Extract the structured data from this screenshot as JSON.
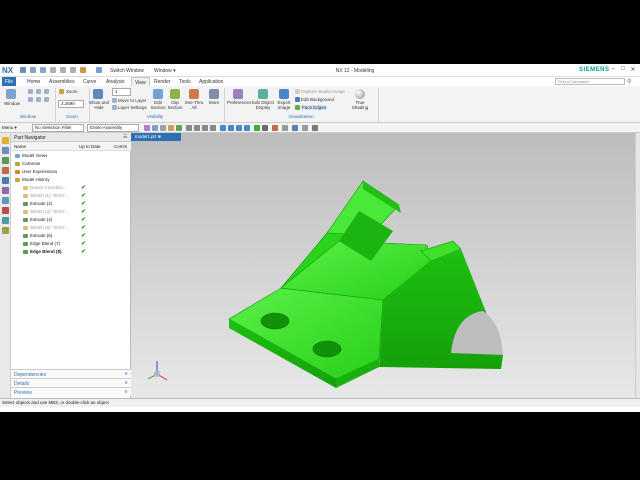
{
  "app": {
    "logo": "NX",
    "title": "NX 12 - Modeling",
    "switch_window": "Switch Window",
    "window_menu": "Window ▾",
    "brand": "SIEMENS",
    "win_min": "–",
    "win_max": "□",
    "win_close": "✕"
  },
  "tabs": [
    "File",
    "Home",
    "Assemblies",
    "Curve",
    "Analysis",
    "View",
    "Render",
    "Tools",
    "Application"
  ],
  "search_placeholder": "Find a Command",
  "ribbon": {
    "window_btn": "Window",
    "zoom_btn": "Zoom",
    "zoom_value": "2.2690",
    "layer_value": "1",
    "show_hide": "Show and Hide",
    "move_to_layer": "Move to Layer",
    "layer_settings": "Layer Settings",
    "edit_section": "Edit Section",
    "clip_section": "Clip Section",
    "see_thru_all": "See-Thru All",
    "more": "More",
    "preferences": "Preferences",
    "edit_object_display": "Edit Object Display",
    "export_image": "Export Image",
    "capture_studio_image": "Capture Studio Image",
    "edit_background": "Edit Background",
    "face_edges": "Face Edges",
    "true_shading": "True Shading",
    "groups": {
      "window": "Window",
      "zoom": "Zoom",
      "visibility": "Visibility",
      "visualization": "Visualization"
    }
  },
  "selection": {
    "menu": "Menu ▾",
    "filter": "No Selection Filter",
    "scope": "Entire Assembly"
  },
  "navigator": {
    "title": "Part Navigator",
    "col_name": "Name",
    "col_uptodate": "Up to Date",
    "col_comment": "Comm",
    "items": [
      {
        "label": "Model Views",
        "indent": 0,
        "dim": false,
        "check": false,
        "bold": false
      },
      {
        "label": "Cameras",
        "indent": 0,
        "dim": false,
        "check": false,
        "bold": false
      },
      {
        "label": "User Expressions",
        "indent": 0,
        "dim": false,
        "check": false,
        "bold": false
      },
      {
        "label": "Model History",
        "indent": 0,
        "dim": false,
        "check": false,
        "bold": false
      },
      {
        "label": "Datum Coordina...",
        "indent": 1,
        "dim": true,
        "check": true,
        "bold": false
      },
      {
        "label": "Sketch (1) \"SKET...",
        "indent": 1,
        "dim": true,
        "check": true,
        "bold": false
      },
      {
        "label": "Extrude (2)",
        "indent": 1,
        "dim": false,
        "check": true,
        "bold": false
      },
      {
        "label": "Sketch (3) \"SKET...",
        "indent": 1,
        "dim": true,
        "check": true,
        "bold": false
      },
      {
        "label": "Extrude (4)",
        "indent": 1,
        "dim": false,
        "check": true,
        "bold": false
      },
      {
        "label": "Sketch (5) \"SKET...",
        "indent": 1,
        "dim": true,
        "check": true,
        "bold": false
      },
      {
        "label": "Extrude (6)",
        "indent": 1,
        "dim": false,
        "check": true,
        "bold": false
      },
      {
        "label": "Edge Blend (7)",
        "indent": 1,
        "dim": false,
        "check": true,
        "bold": false
      },
      {
        "label": "Edge Blend (8)",
        "indent": 1,
        "dim": false,
        "check": true,
        "bold": true
      }
    ],
    "panels": [
      "Dependencies",
      "Details",
      "Preview"
    ]
  },
  "viewport": {
    "tab": "model1.prt ⊗"
  },
  "status": "Select objects and use MB3, or double-click an object",
  "colors": {
    "accent": "#2f6fb3",
    "part_green": "#22e014",
    "brand": "#009999"
  }
}
